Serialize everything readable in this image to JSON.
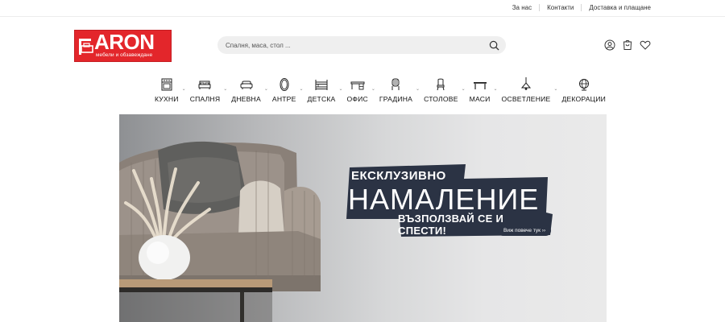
{
  "topbar": {
    "links": [
      "За нас",
      "Контакти",
      "Доставка и плащане"
    ]
  },
  "logo": {
    "brand": "ARON",
    "tagline": "мебели и обзавеждане"
  },
  "search": {
    "placeholder": "Спалня, маса, стол ..."
  },
  "header_icons": [
    "user-icon",
    "cart-icon",
    "heart-icon"
  ],
  "categories": [
    {
      "label": "КУХНИ",
      "icon": "oven-icon"
    },
    {
      "label": "СПАЛНЯ",
      "icon": "bed-icon"
    },
    {
      "label": "ДНЕВНА",
      "icon": "sofa-icon"
    },
    {
      "label": "АНТРЕ",
      "icon": "mirror-icon"
    },
    {
      "label": "ДЕТСКА",
      "icon": "bunk-bed-icon"
    },
    {
      "label": "ОФИС",
      "icon": "desk-icon"
    },
    {
      "label": "ГРАДИНА",
      "icon": "garden-chair-icon"
    },
    {
      "label": "СТОЛОВЕ",
      "icon": "chair-icon"
    },
    {
      "label": "МАСИ",
      "icon": "table-icon"
    },
    {
      "label": "ОСВЕТЛЕНИЕ",
      "icon": "lamp-icon"
    },
    {
      "label": "ДЕКОРАЦИИ",
      "icon": "vase-icon"
    }
  ],
  "hero": {
    "line1": "ЕКСКЛУЗИВНО",
    "line2": "НАМАЛЕНИЕ",
    "line3": "ВЪЗПОЛЗВАЙ СЕ И СПЕСТИ!",
    "cta": "Виж повече тук ››",
    "brush_color": "#2b3344"
  }
}
